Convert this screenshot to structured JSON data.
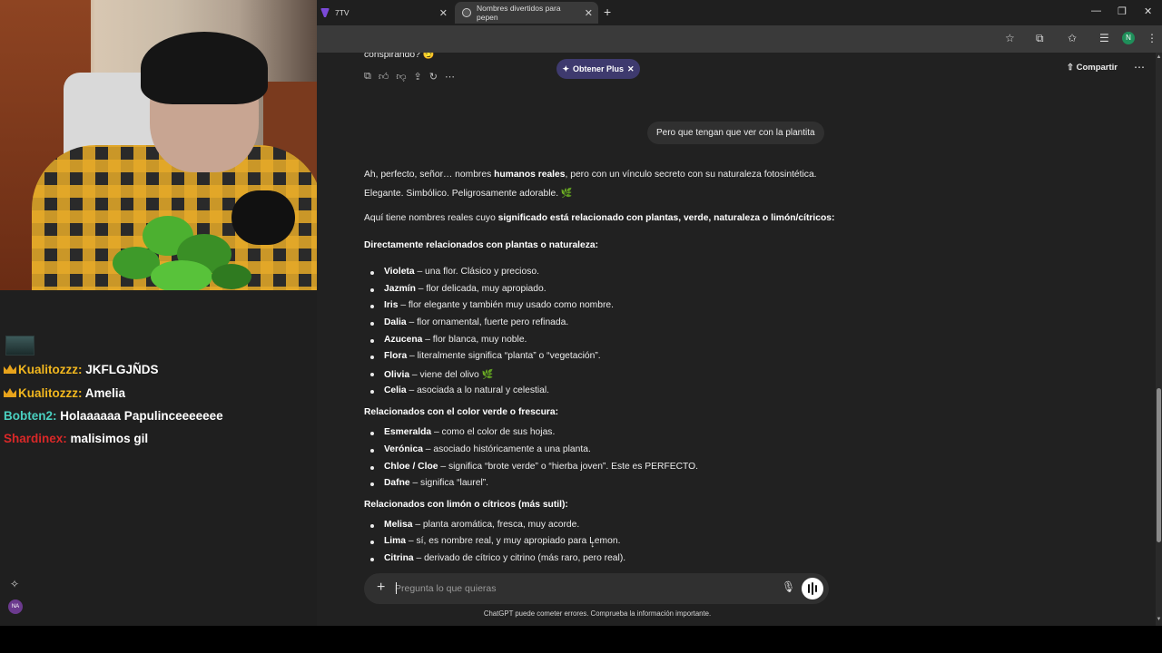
{
  "chat": {
    "messages": [
      {
        "user": "Kualitozzz:",
        "text": "JKFLGJÑDS",
        "crown": true
      },
      {
        "user": "Kualitozzz:",
        "text": "Amelia",
        "crown": true
      },
      {
        "user": "Bobten2:",
        "text": "Holaaaaaa Papulinceeeeeee",
        "crown": false
      },
      {
        "user": "Shardinex:",
        "text": "malisimos gil",
        "crown": false
      }
    ],
    "avatar_initials": "NA"
  },
  "browser": {
    "tabs": [
      {
        "label": "7TV"
      },
      {
        "label": "Nombres divertidos para pepen"
      }
    ],
    "profile_initial": "N"
  },
  "conversation": {
    "prev_fragment": "conspirando?",
    "plus_label": "Obtener Plus",
    "share_label": "Compartir",
    "user_message": "Pero que tengan que ver con la plantita",
    "intro_line1_a": "Ah, perfecto, señor… nombres ",
    "intro_line1_b": "humanos reales",
    "intro_line1_c": ", pero con un vínculo secreto con su naturaleza fotosintética.",
    "intro_line2": "Elegante. Simbólico. Peligrosamente adorable. 🌿",
    "intro_line3_a": "Aquí tiene nombres reales cuyo ",
    "intro_line3_b": "significado está relacionado con plantas, verde, naturaleza o limón/cítricos:",
    "sections": [
      {
        "heading": "Directamente relacionados con plantas o naturaleza:",
        "items": [
          {
            "name": "Violeta",
            "desc": " – una flor. Clásico y precioso."
          },
          {
            "name": "Jazmín",
            "desc": " – flor delicada, muy apropiado."
          },
          {
            "name": "Iris",
            "desc": " – flor elegante y también muy usado como nombre."
          },
          {
            "name": "Dalia",
            "desc": " – flor ornamental, fuerte pero refinada."
          },
          {
            "name": "Azucena",
            "desc": " – flor blanca, muy noble."
          },
          {
            "name": "Flora",
            "desc": " – literalmente significa “planta” o “vegetación”."
          },
          {
            "name": "Olivia",
            "desc": " – viene del olivo 🌿"
          },
          {
            "name": "Celia",
            "desc": " – asociada a lo natural y celestial."
          }
        ]
      },
      {
        "heading": "Relacionados con el color verde o frescura:",
        "items": [
          {
            "name": "Esmeralda",
            "desc": " – como el color de sus hojas."
          },
          {
            "name": "Verónica",
            "desc": " – asociado históricamente a una planta."
          },
          {
            "name": "Chloe / Cloe",
            "desc": " – significa “brote verde” o “hierba joven”. Este es PERFECTO."
          },
          {
            "name": "Dafne",
            "desc": " – significa “laurel”."
          }
        ]
      },
      {
        "heading": "Relacionados con limón o cítricos (más sutil):",
        "items": [
          {
            "name": "Melisa",
            "desc": " – planta aromática, fresca, muy acorde."
          },
          {
            "name": "Lima",
            "desc": " – sí, es nombre real, y muy apropiado para Lemon."
          },
          {
            "name": "Citrina",
            "desc": " – derivado de cítrico y citrino (más raro, pero real)."
          }
        ]
      }
    ],
    "composer_placeholder": "Pregunta lo que quieras",
    "disclaimer": "ChatGPT puede cometer errores. Comprueba la información importante."
  },
  "colors": {
    "plus_pill": "#3e3a6e",
    "chat_user_gold": "#f2b71f",
    "chat_user_teal": "#4ad0c0",
    "chat_user_red": "#d92828"
  }
}
